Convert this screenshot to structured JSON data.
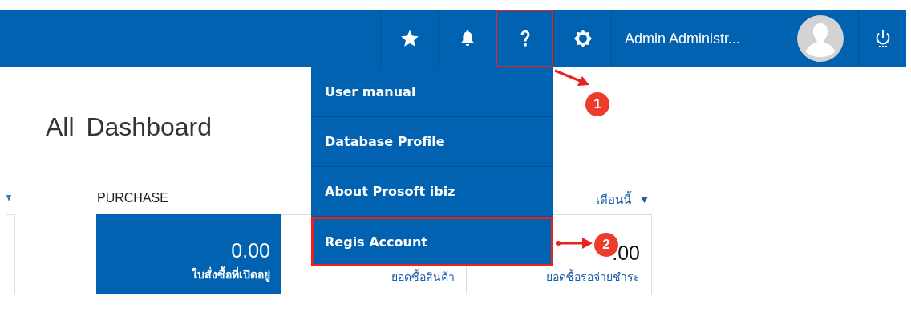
{
  "header": {
    "buttons": [
      {
        "kind": "star",
        "annotated": false
      },
      {
        "kind": "bell",
        "annotated": false
      },
      {
        "kind": "help",
        "annotated": true
      },
      {
        "kind": "gear",
        "annotated": false
      }
    ],
    "user_name": "Admin Administr..."
  },
  "help_menu": [
    {
      "label": "User manual",
      "annotated": false
    },
    {
      "label": "Database Profile",
      "annotated": false
    },
    {
      "label": "About Prosoft ibiz",
      "annotated": false
    },
    {
      "label": "Regis Account",
      "annotated": true
    }
  ],
  "page": {
    "title": "All Dashboard"
  },
  "purchase": {
    "heading": "PURCHASE",
    "period": "เดือนนี้",
    "cards": [
      {
        "kind": "primary",
        "value": "0.00",
        "label": "ใบสั่งซื้อที่เปิดอยู่"
      },
      {
        "kind": "plain",
        "label": "ยอดซื้อสินค้า"
      },
      {
        "kind": "plain",
        "value": ".00",
        "label": "ยอดซื้อรอจ่ายชำระ"
      }
    ]
  },
  "annotations": [
    {
      "label": "1"
    },
    {
      "label": "2"
    }
  ]
}
